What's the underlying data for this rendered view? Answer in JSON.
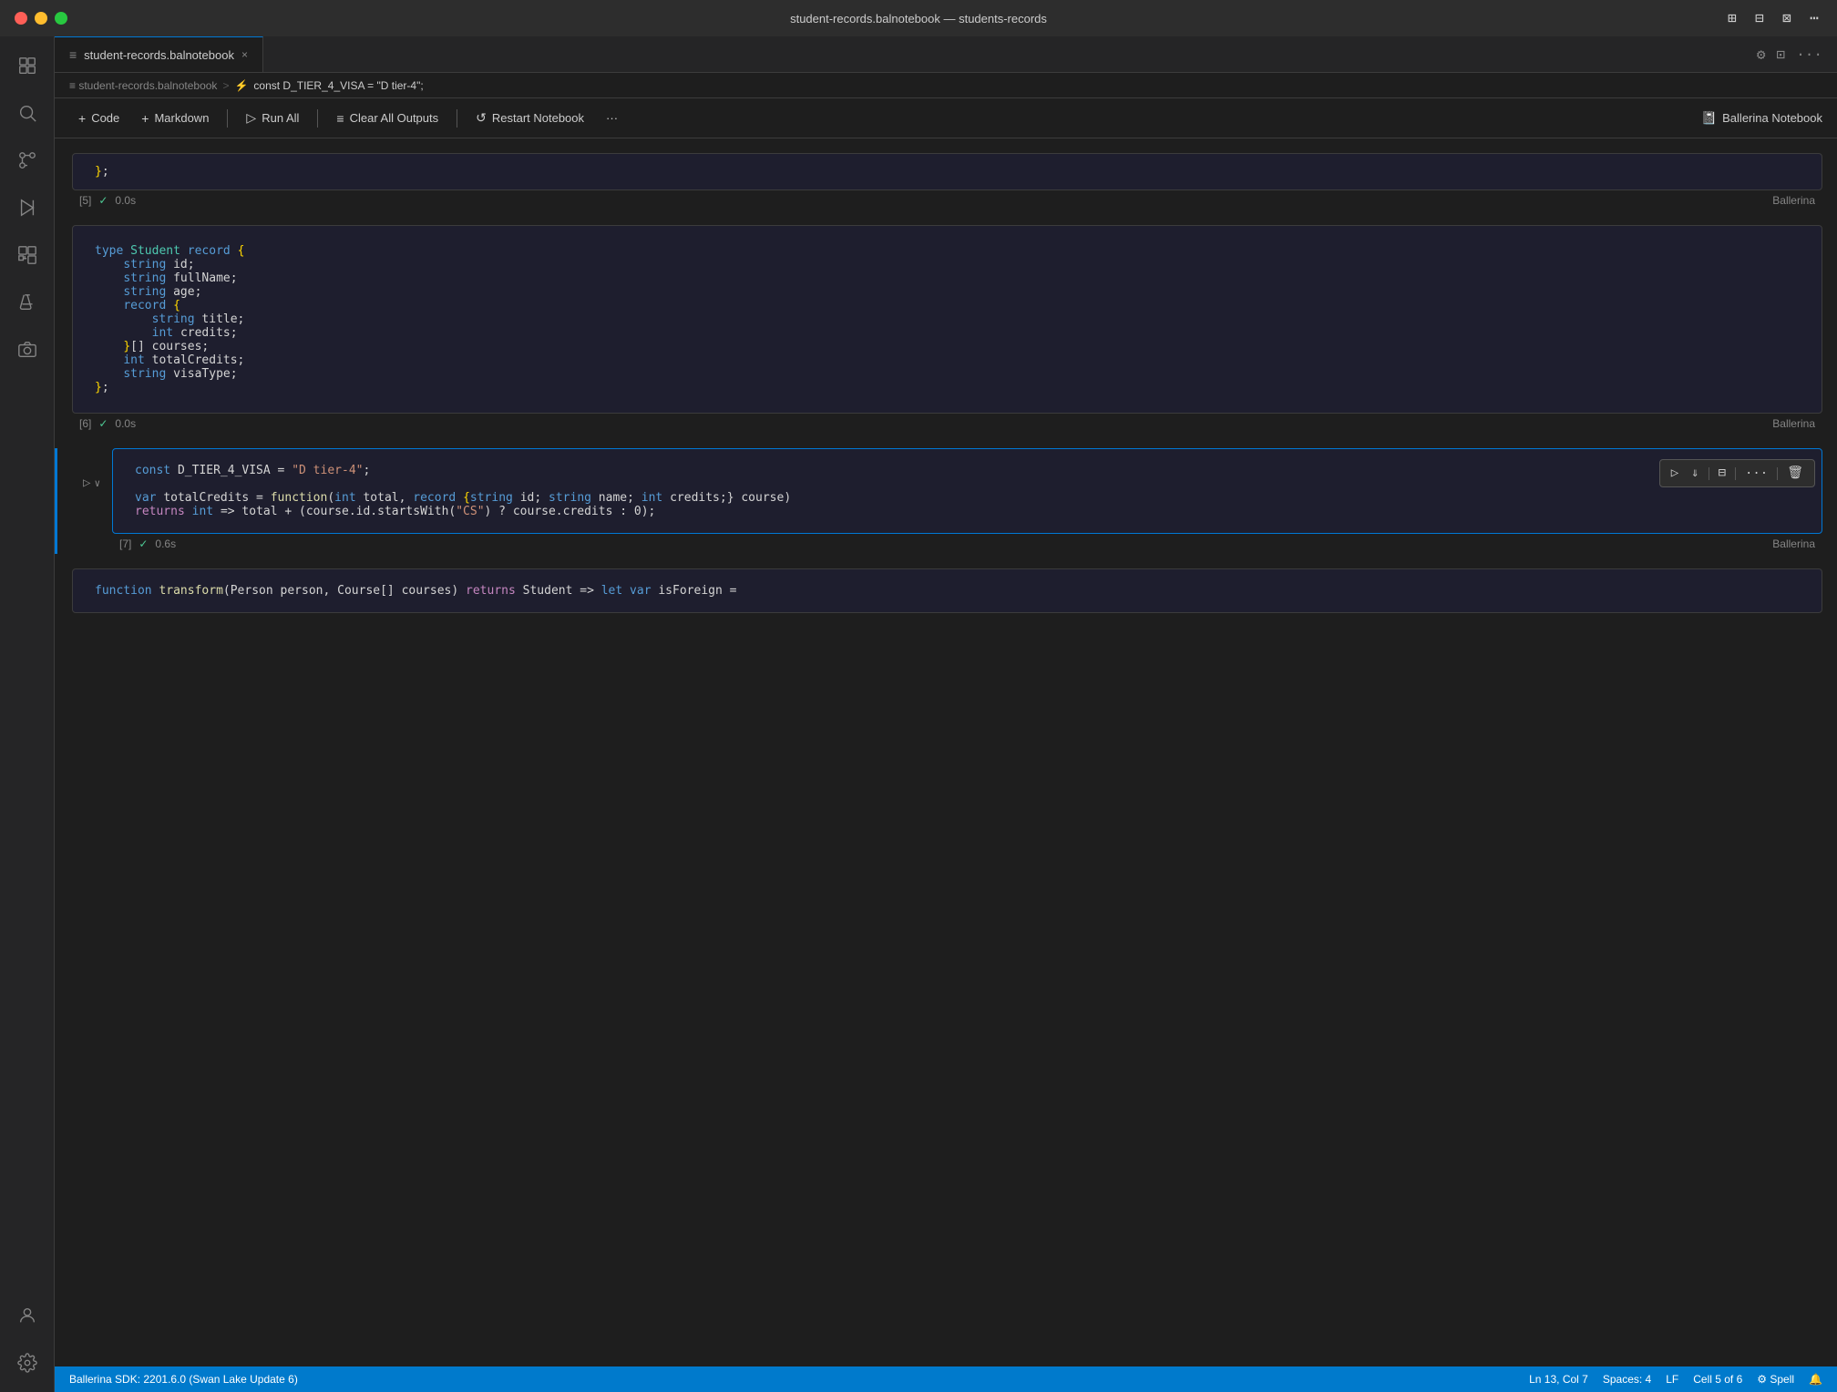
{
  "titleBar": {
    "title": "student-records.balnotebook — students-records",
    "trafficLights": [
      "red",
      "yellow",
      "green"
    ]
  },
  "tab": {
    "icon": "≡",
    "name": "student-records.balnotebook",
    "closeLabel": "×"
  },
  "breadcrumb": {
    "items": [
      "≡ student-records.balnotebook",
      ">",
      "⚡ const D_TIER_4_VISA = \"D tier-4\";"
    ]
  },
  "toolbar": {
    "code_label": "+ Code",
    "markdown_label": "+ Markdown",
    "run_all_label": "Run All",
    "clear_outputs_label": "Clear All Outputs",
    "restart_label": "Restart Notebook",
    "more_label": "···",
    "engine_label": "Ballerina Notebook"
  },
  "cells": [
    {
      "id": "cell5",
      "number": "[5]",
      "status": "✓",
      "time": "0.0s",
      "engine": "Ballerina",
      "content_type": "closing",
      "lines": [
        "};"
      ]
    },
    {
      "id": "cell6",
      "number": "[6]",
      "status": "✓",
      "time": "0.0s",
      "engine": "Ballerina",
      "content_type": "student_record",
      "lines": []
    },
    {
      "id": "cell7",
      "number": "[7]",
      "status": "✓",
      "time": "0.6s",
      "engine": "Ballerina",
      "content_type": "const_var",
      "lines": [],
      "active": true
    },
    {
      "id": "cell8",
      "number": "",
      "content_type": "function",
      "lines": []
    }
  ],
  "statusBar": {
    "left": "Ballerina SDK: 2201.6.0 (Swan Lake Update 6)",
    "ln_col": "Ln 13, Col 7",
    "spaces": "Spaces: 4",
    "lf": "LF",
    "cell": "Cell 5 of 6",
    "spell": "⚙ Spell"
  },
  "icons": {
    "explorer": "⊞",
    "search": "🔍",
    "source_control": "⎇",
    "run": "▷",
    "extensions": "⊡",
    "flask": "⚗",
    "camera": "📷",
    "account": "👤",
    "settings": "⚙"
  }
}
